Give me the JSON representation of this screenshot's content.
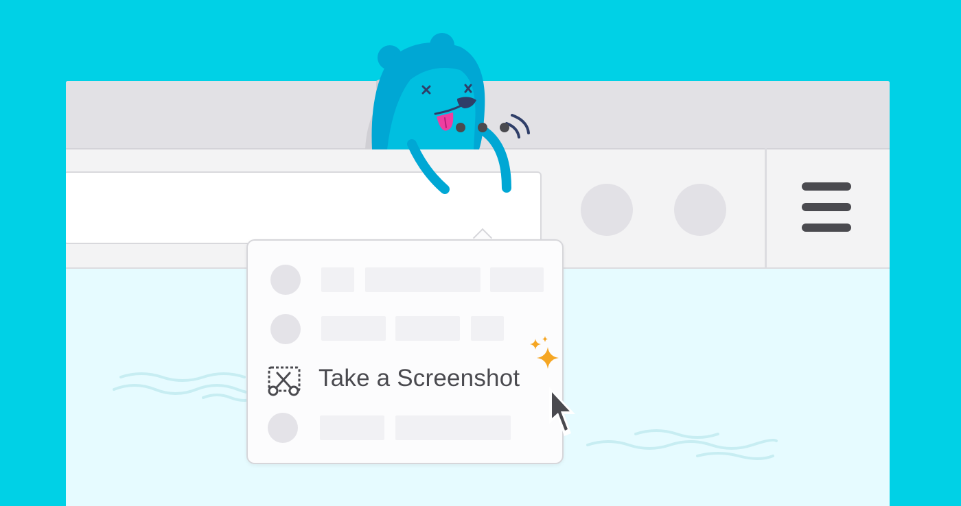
{
  "browser": {
    "page_actions_icon": "ellipsis-icon",
    "toolbar_buttons": [
      "toolbar-button-icon",
      "toolbar-button-icon"
    ],
    "menu_icon": "hamburger-menu-icon"
  },
  "page_actions_menu": {
    "items": [
      {
        "icon": "menu-item-icon",
        "placeholder": true
      },
      {
        "icon": "menu-item-icon",
        "placeholder": true
      },
      {
        "icon": "screenshot-scissors-icon",
        "label": "Take a Screenshot"
      },
      {
        "icon": "menu-item-icon",
        "placeholder": true
      }
    ]
  },
  "decorations": {
    "mascot": "bear-mascot",
    "sparkle": "sparkle-icon",
    "cursor": "mouse-cursor-icon"
  },
  "colors": {
    "background": "#00d1e6",
    "mascot": "#00a7d4",
    "sparkle": "#f5a623",
    "text": "#4a4a4f"
  }
}
